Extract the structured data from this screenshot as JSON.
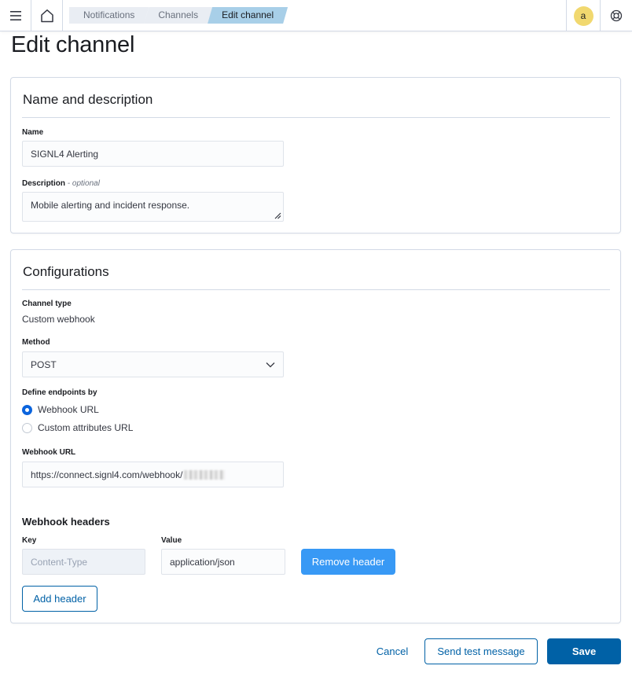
{
  "header": {
    "breadcrumbs": [
      "Notifications",
      "Channels",
      "Edit channel"
    ],
    "avatar_initial": "a"
  },
  "page": {
    "title": "Edit channel"
  },
  "name_panel": {
    "title": "Name and description",
    "name_label": "Name",
    "name_value": "SIGNL4 Alerting",
    "description_label": "Description",
    "description_optional": "- optional",
    "description_value": "Mobile alerting and incident response."
  },
  "config_panel": {
    "title": "Configurations",
    "channel_type_label": "Channel type",
    "channel_type_value": "Custom webhook",
    "method_label": "Method",
    "method_value": "POST",
    "endpoints_label": "Define endpoints by",
    "endpoint_options": [
      "Webhook URL",
      "Custom attributes URL"
    ],
    "endpoint_selected": "Webhook URL",
    "webhook_url_label": "Webhook URL",
    "webhook_url_value": "https://connect.signl4.com/webhook/",
    "headers_title": "Webhook headers",
    "key_label": "Key",
    "value_label": "Value",
    "header_key": "Content-Type",
    "header_value": "application/json",
    "remove_header": "Remove header",
    "add_header": "Add header"
  },
  "footer": {
    "cancel": "Cancel",
    "send_test": "Send test message",
    "save": "Save"
  },
  "colors": {
    "primary": "#0061a6",
    "accent_blue": "#3899f5",
    "avatar": "#f1d86f"
  }
}
